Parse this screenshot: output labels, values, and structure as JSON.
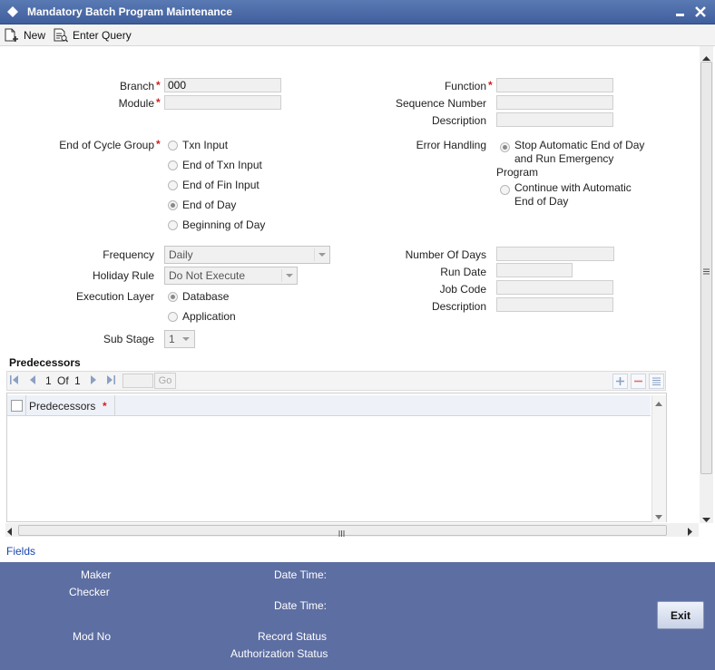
{
  "window": {
    "title": "Mandatory Batch Program Maintenance",
    "min_glyph": "▬",
    "close_glyph": "✕"
  },
  "toolbar": {
    "new_label": "New",
    "enter_query_label": "Enter Query"
  },
  "form": {
    "required_mark": "*",
    "branch": {
      "label": "Branch",
      "value": "000"
    },
    "module": {
      "label": "Module",
      "value": ""
    },
    "function": {
      "label": "Function",
      "value": ""
    },
    "sequence_number": {
      "label": "Sequence Number",
      "value": ""
    },
    "description_top": {
      "label": "Description",
      "value": ""
    },
    "end_of_cycle_group": {
      "label": "End of Cycle Group",
      "options": [
        "Txn Input",
        "End of Txn Input",
        "End of Fin Input",
        "End of Day",
        "Beginning of Day"
      ],
      "selected": "End of Day"
    },
    "error_handling": {
      "label": "Error Handling",
      "option1_line1": "Stop Automatic End of Day",
      "option1_line2": "and Run Emergency",
      "option1_line3": "Program",
      "option2_line1": "Continue with Automatic",
      "option2_line2": "End of Day",
      "selected": "Stop Automatic End of Day and Run Emergency Program"
    },
    "frequency": {
      "label": "Frequency",
      "value": "Daily"
    },
    "holiday_rule": {
      "label": "Holiday Rule",
      "value": "Do Not Execute"
    },
    "execution_layer": {
      "label": "Execution Layer",
      "options": [
        "Database",
        "Application"
      ],
      "selected": "Database"
    },
    "sub_stage": {
      "label": "Sub Stage",
      "value": "1"
    },
    "number_of_days": {
      "label": "Number Of Days",
      "value": ""
    },
    "run_date": {
      "label": "Run Date",
      "value": ""
    },
    "job_code": {
      "label": "Job Code",
      "value": ""
    },
    "description_bottom": {
      "label": "Description",
      "value": ""
    }
  },
  "predecessors": {
    "title": "Predecessors",
    "page_current": "1",
    "page_of": "Of",
    "page_total": "1",
    "go_label": "Go",
    "column_header": "Predecessors",
    "rows": []
  },
  "fields_link": "Fields",
  "footer": {
    "maker_label": "Maker",
    "checker_label": "Checker",
    "date_time_label_1": "Date Time:",
    "date_time_label_2": "Date Time:",
    "mod_no_label": "Mod No",
    "record_status_label": "Record Status",
    "authorization_status_label": "Authorization Status",
    "exit_label": "Exit"
  },
  "colors": {
    "titlebar": "#4a6aa8",
    "footer": "#5d6ea2",
    "required": "#d02020",
    "link": "#1a45b0"
  }
}
